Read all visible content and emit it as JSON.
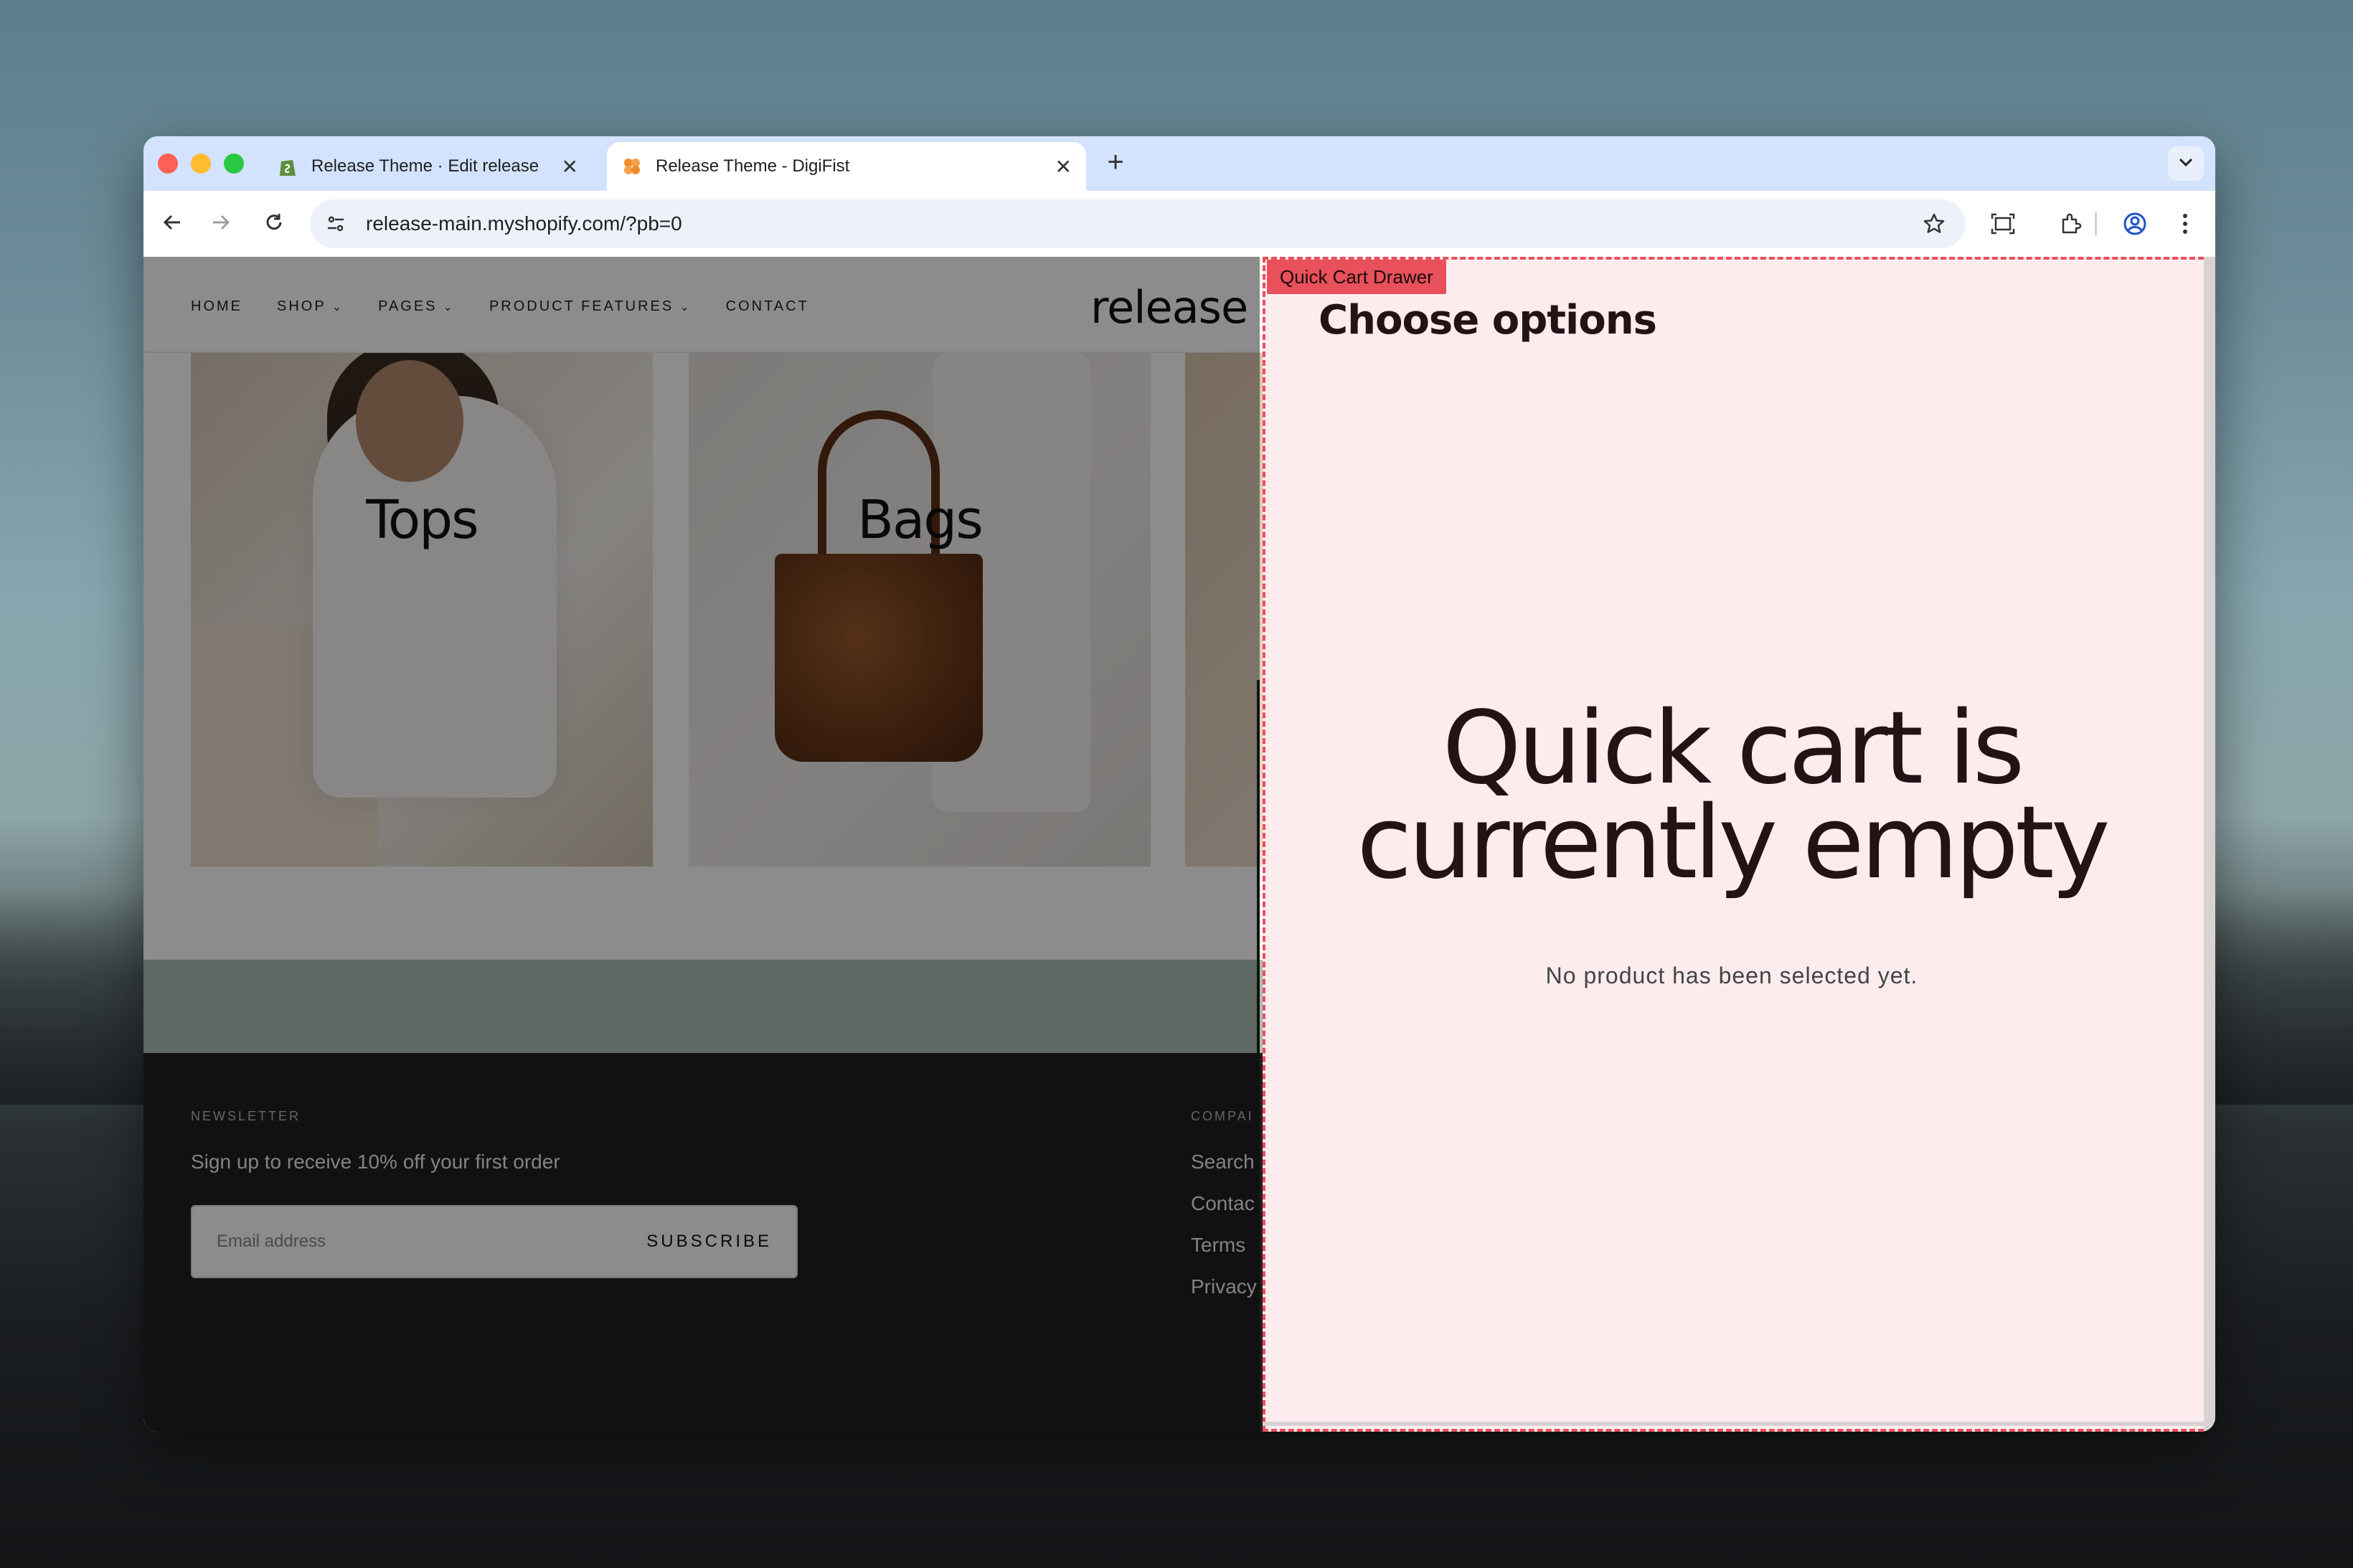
{
  "browser": {
    "tabs": [
      {
        "title": "Release Theme · Edit release",
        "close": "✕"
      },
      {
        "title": "Release Theme - DigiFist",
        "close": "✕"
      }
    ],
    "new_tab": "+",
    "url": "release-main.myshopify.com/?pb=0"
  },
  "store": {
    "nav": [
      {
        "label": "HOME",
        "has_dropdown": false
      },
      {
        "label": "SHOP",
        "has_dropdown": true
      },
      {
        "label": "PAGES",
        "has_dropdown": true
      },
      {
        "label": "PRODUCT FEATURES",
        "has_dropdown": true
      },
      {
        "label": "CONTACT",
        "has_dropdown": false
      }
    ],
    "logo": "release",
    "categories": [
      {
        "label": "Tops"
      },
      {
        "label": "Bags"
      }
    ],
    "footer": {
      "newsletter_title": "NEWSLETTER",
      "newsletter_text": "Sign up to receive 10% off your first order",
      "email_placeholder": "Email address",
      "subscribe_label": "SUBSCRIBE",
      "company_title": "COMPAI",
      "company_links": [
        "Search",
        "Contac",
        "Terms",
        "Privacy"
      ]
    }
  },
  "drawer": {
    "tag": "Quick Cart Drawer",
    "title": "Choose options",
    "empty_title_line1": "Quick cart is",
    "empty_title_line2": "currently empty",
    "empty_subtitle": "No product has been selected yet.",
    "accent_color": "#e8505b",
    "background_color": "#fdecee"
  }
}
